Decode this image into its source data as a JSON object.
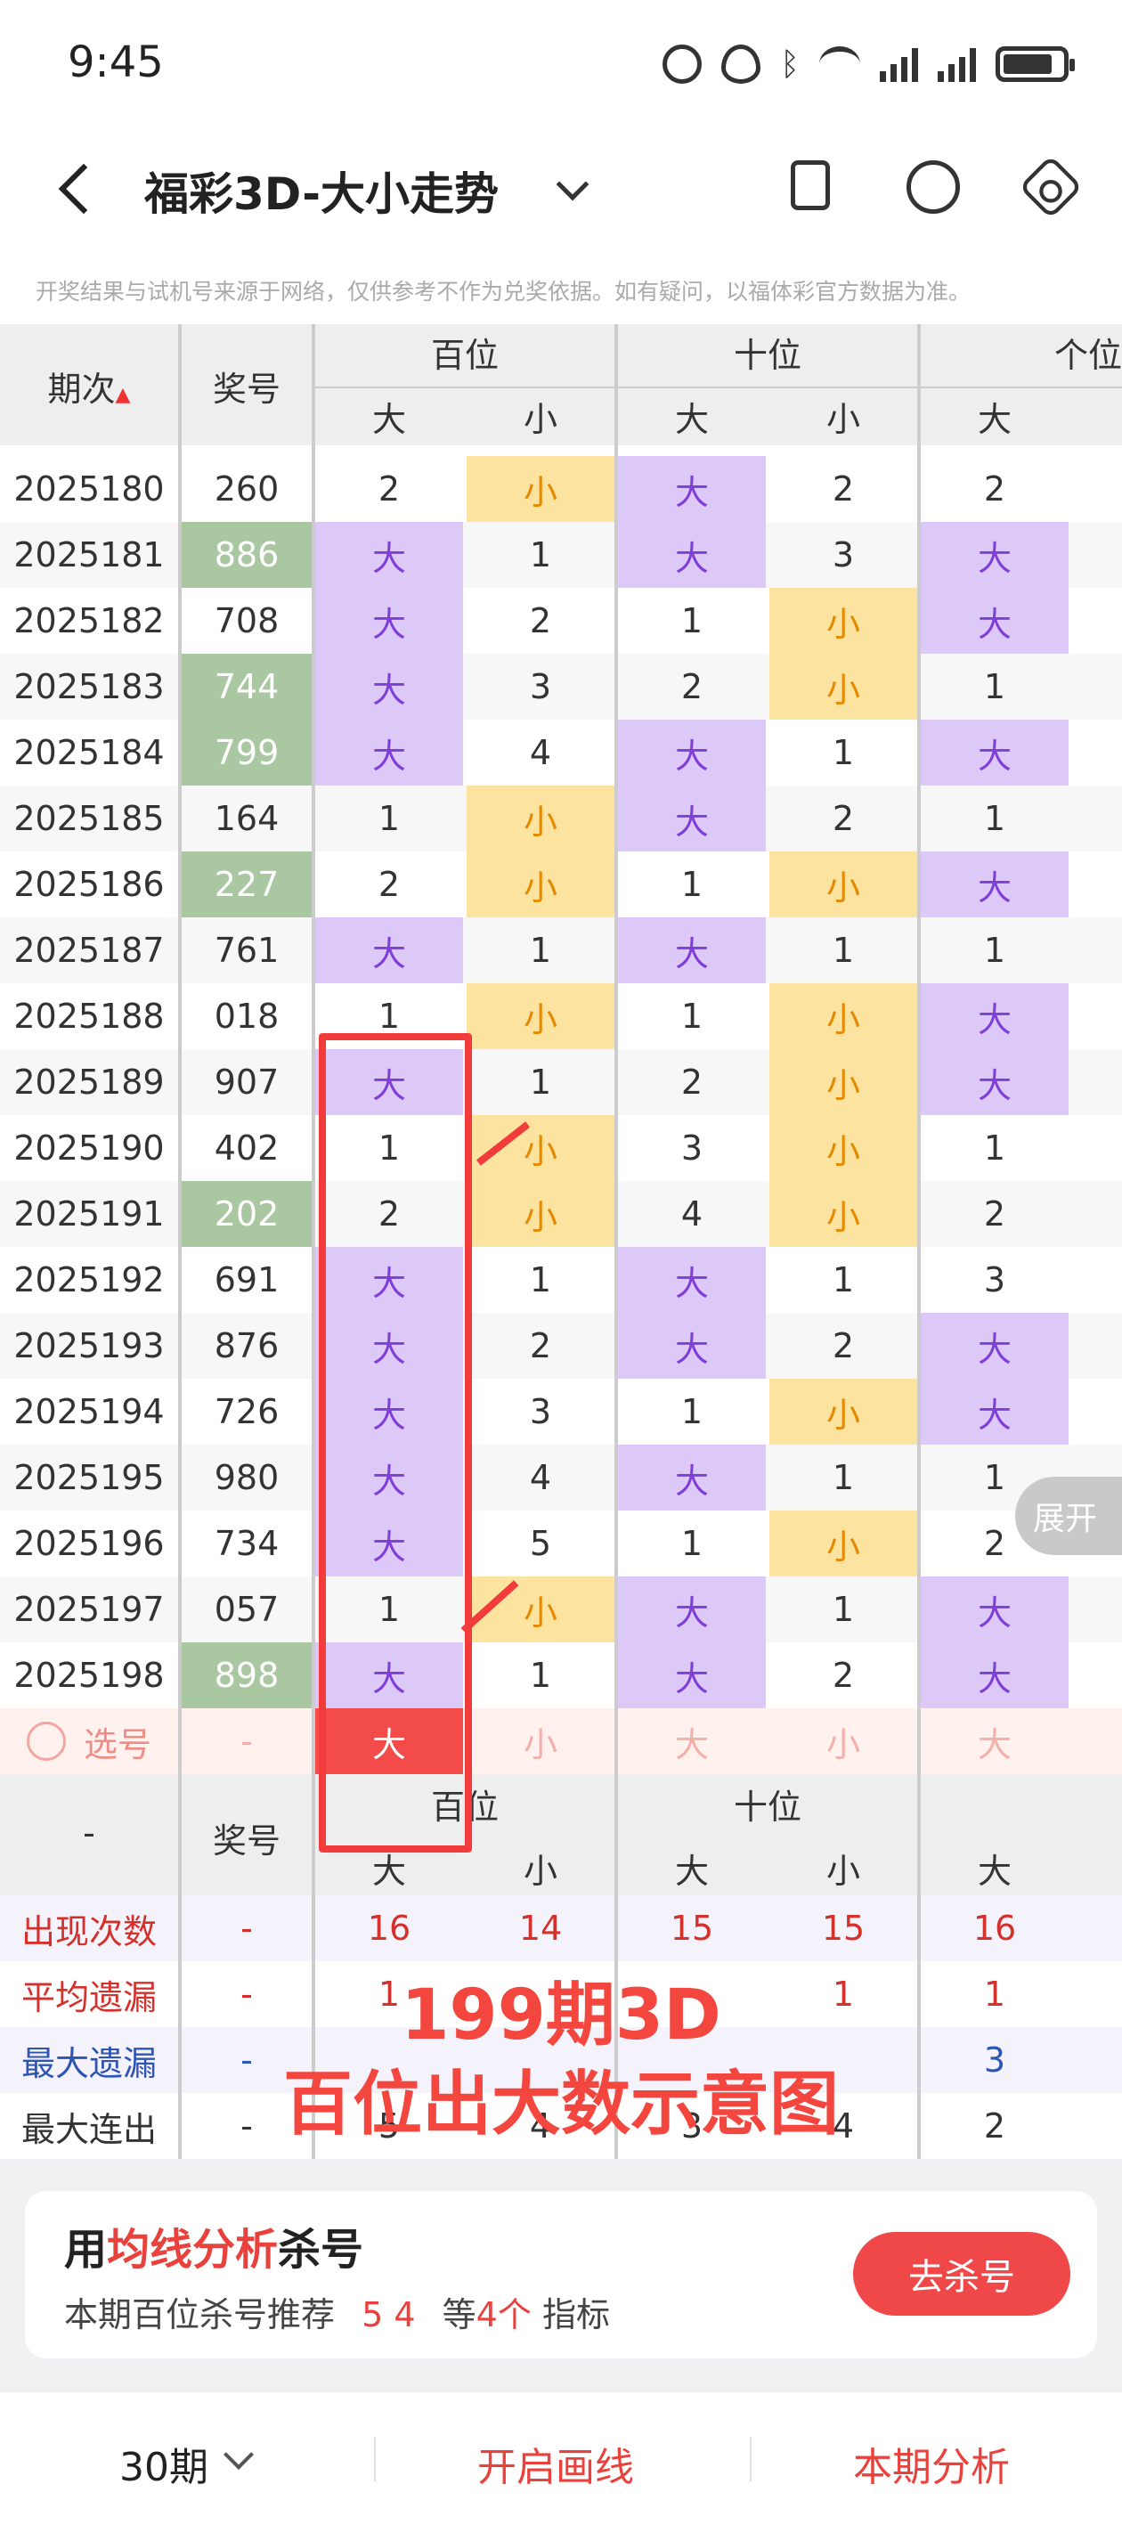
{
  "status_bar": {
    "time": "9:45",
    "icons": [
      "alarm-icon",
      "eye-icon",
      "bluetooth-icon",
      "wifi-icon",
      "signal-icon",
      "signal-icon",
      "battery-icon"
    ]
  },
  "header": {
    "title": "福彩3D-大小走势",
    "icons": [
      "back-icon",
      "chevron-down-icon",
      "phone-icon",
      "share-icon",
      "settings-icon"
    ]
  },
  "disclaimer": "开奖结果与试机号来源于网络，仅供参考不作为兑奖依据。如有疑问，以福体彩官方数据为准。",
  "table": {
    "col_period": "期次",
    "col_number": "奖号",
    "groups": [
      "百位",
      "十位",
      "个位"
    ],
    "subheaders": [
      "大",
      "小",
      "大",
      "小",
      "大"
    ],
    "rows": [
      {
        "period": "2025180",
        "number": "260",
        "green": false,
        "cells": [
          [
            "2",
            "n"
          ],
          [
            "小",
            "s"
          ],
          [
            "大",
            "b"
          ],
          [
            "2",
            "n"
          ],
          [
            "2",
            "n"
          ]
        ]
      },
      {
        "period": "2025181",
        "number": "886",
        "green": true,
        "cells": [
          [
            "大",
            "b"
          ],
          [
            "1",
            "n"
          ],
          [
            "大",
            "b"
          ],
          [
            "3",
            "n"
          ],
          [
            "大",
            "b"
          ]
        ]
      },
      {
        "period": "2025182",
        "number": "708",
        "green": false,
        "cells": [
          [
            "大",
            "b"
          ],
          [
            "2",
            "n"
          ],
          [
            "1",
            "n"
          ],
          [
            "小",
            "s"
          ],
          [
            "大",
            "b"
          ]
        ]
      },
      {
        "period": "2025183",
        "number": "744",
        "green": true,
        "cells": [
          [
            "大",
            "b"
          ],
          [
            "3",
            "n"
          ],
          [
            "2",
            "n"
          ],
          [
            "小",
            "s"
          ],
          [
            "1",
            "n"
          ]
        ]
      },
      {
        "period": "2025184",
        "number": "799",
        "green": true,
        "cells": [
          [
            "大",
            "b"
          ],
          [
            "4",
            "n"
          ],
          [
            "大",
            "b"
          ],
          [
            "1",
            "n"
          ],
          [
            "大",
            "b"
          ]
        ]
      },
      {
        "period": "2025185",
        "number": "164",
        "green": false,
        "cells": [
          [
            "1",
            "n"
          ],
          [
            "小",
            "s"
          ],
          [
            "大",
            "b"
          ],
          [
            "2",
            "n"
          ],
          [
            "1",
            "n"
          ]
        ]
      },
      {
        "period": "2025186",
        "number": "227",
        "green": true,
        "cells": [
          [
            "2",
            "n"
          ],
          [
            "小",
            "s"
          ],
          [
            "1",
            "n"
          ],
          [
            "小",
            "s"
          ],
          [
            "大",
            "b"
          ]
        ]
      },
      {
        "period": "2025187",
        "number": "761",
        "green": false,
        "cells": [
          [
            "大",
            "b"
          ],
          [
            "1",
            "n"
          ],
          [
            "大",
            "b"
          ],
          [
            "1",
            "n"
          ],
          [
            "1",
            "n"
          ]
        ]
      },
      {
        "period": "2025188",
        "number": "018",
        "green": false,
        "cells": [
          [
            "1",
            "n"
          ],
          [
            "小",
            "s"
          ],
          [
            "1",
            "n"
          ],
          [
            "小",
            "s"
          ],
          [
            "大",
            "b"
          ]
        ]
      },
      {
        "period": "2025189",
        "number": "907",
        "green": false,
        "cells": [
          [
            "大",
            "b"
          ],
          [
            "1",
            "n"
          ],
          [
            "2",
            "n"
          ],
          [
            "小",
            "s"
          ],
          [
            "大",
            "b"
          ]
        ]
      },
      {
        "period": "2025190",
        "number": "402",
        "green": false,
        "cells": [
          [
            "1",
            "n"
          ],
          [
            "小",
            "s"
          ],
          [
            "3",
            "n"
          ],
          [
            "小",
            "s"
          ],
          [
            "1",
            "n"
          ]
        ]
      },
      {
        "period": "2025191",
        "number": "202",
        "green": true,
        "cells": [
          [
            "2",
            "n"
          ],
          [
            "小",
            "s"
          ],
          [
            "4",
            "n"
          ],
          [
            "小",
            "s"
          ],
          [
            "2",
            "n"
          ]
        ]
      },
      {
        "period": "2025192",
        "number": "691",
        "green": false,
        "cells": [
          [
            "大",
            "b"
          ],
          [
            "1",
            "n"
          ],
          [
            "大",
            "b"
          ],
          [
            "1",
            "n"
          ],
          [
            "3",
            "n"
          ]
        ]
      },
      {
        "period": "2025193",
        "number": "876",
        "green": false,
        "cells": [
          [
            "大",
            "b"
          ],
          [
            "2",
            "n"
          ],
          [
            "大",
            "b"
          ],
          [
            "2",
            "n"
          ],
          [
            "大",
            "b"
          ]
        ]
      },
      {
        "period": "2025194",
        "number": "726",
        "green": false,
        "cells": [
          [
            "大",
            "b"
          ],
          [
            "3",
            "n"
          ],
          [
            "1",
            "n"
          ],
          [
            "小",
            "s"
          ],
          [
            "大",
            "b"
          ]
        ]
      },
      {
        "period": "2025195",
        "number": "980",
        "green": false,
        "cells": [
          [
            "大",
            "b"
          ],
          [
            "4",
            "n"
          ],
          [
            "大",
            "b"
          ],
          [
            "1",
            "n"
          ],
          [
            "1",
            "n"
          ]
        ]
      },
      {
        "period": "2025196",
        "number": "734",
        "green": false,
        "cells": [
          [
            "大",
            "b"
          ],
          [
            "5",
            "n"
          ],
          [
            "1",
            "n"
          ],
          [
            "小",
            "s"
          ],
          [
            "2",
            "n"
          ]
        ]
      },
      {
        "period": "2025197",
        "number": "057",
        "green": false,
        "cells": [
          [
            "1",
            "n"
          ],
          [
            "小",
            "s"
          ],
          [
            "大",
            "b"
          ],
          [
            "1",
            "n"
          ],
          [
            "大",
            "b"
          ]
        ]
      },
      {
        "period": "2025198",
        "number": "898",
        "green": true,
        "cells": [
          [
            "大",
            "b"
          ],
          [
            "1",
            "n"
          ],
          [
            "大",
            "b"
          ],
          [
            "2",
            "n"
          ],
          [
            "大",
            "b"
          ]
        ]
      }
    ],
    "pick_row": {
      "label": "选号",
      "number": "-",
      "cells": [
        "大",
        "小",
        "大",
        "小",
        "大"
      ]
    },
    "footer_header": {
      "left": "-",
      "number": "奖号",
      "groups": [
        "百位",
        "十位"
      ],
      "subheaders": [
        "大",
        "小",
        "大",
        "小",
        "大"
      ]
    },
    "stats": [
      {
        "label": "出现次数",
        "dash": "-",
        "values": [
          "16",
          "14",
          "15",
          "15",
          "16"
        ],
        "color": "red"
      },
      {
        "label": "平均遗漏",
        "dash": "-",
        "values": [
          "1",
          "",
          "",
          "1",
          "1"
        ],
        "color": "red"
      },
      {
        "label": "最大遗漏",
        "dash": "-",
        "values": [
          "",
          "",
          "",
          "",
          "3"
        ],
        "color": "blue"
      },
      {
        "label": "最大连出",
        "dash": "-",
        "values": [
          "5",
          "4",
          "3",
          "4",
          "2"
        ],
        "color": "dark"
      }
    ],
    "expand_label": "展开"
  },
  "annotation": {
    "line1": "199期3D",
    "line2": "百位出大数示意图"
  },
  "card": {
    "title_prefix": "用",
    "title_highlight": "均线分析",
    "title_suffix": "杀号",
    "sub_prefix": "本期百位杀号推荐",
    "sub_numbers": "5 4",
    "sub_middle": "等",
    "sub_count": "4个",
    "sub_suffix": "指标",
    "button": "去杀号"
  },
  "bottom_bar": {
    "period": "30期",
    "draw": "开启画线",
    "analysis": "本期分析"
  }
}
